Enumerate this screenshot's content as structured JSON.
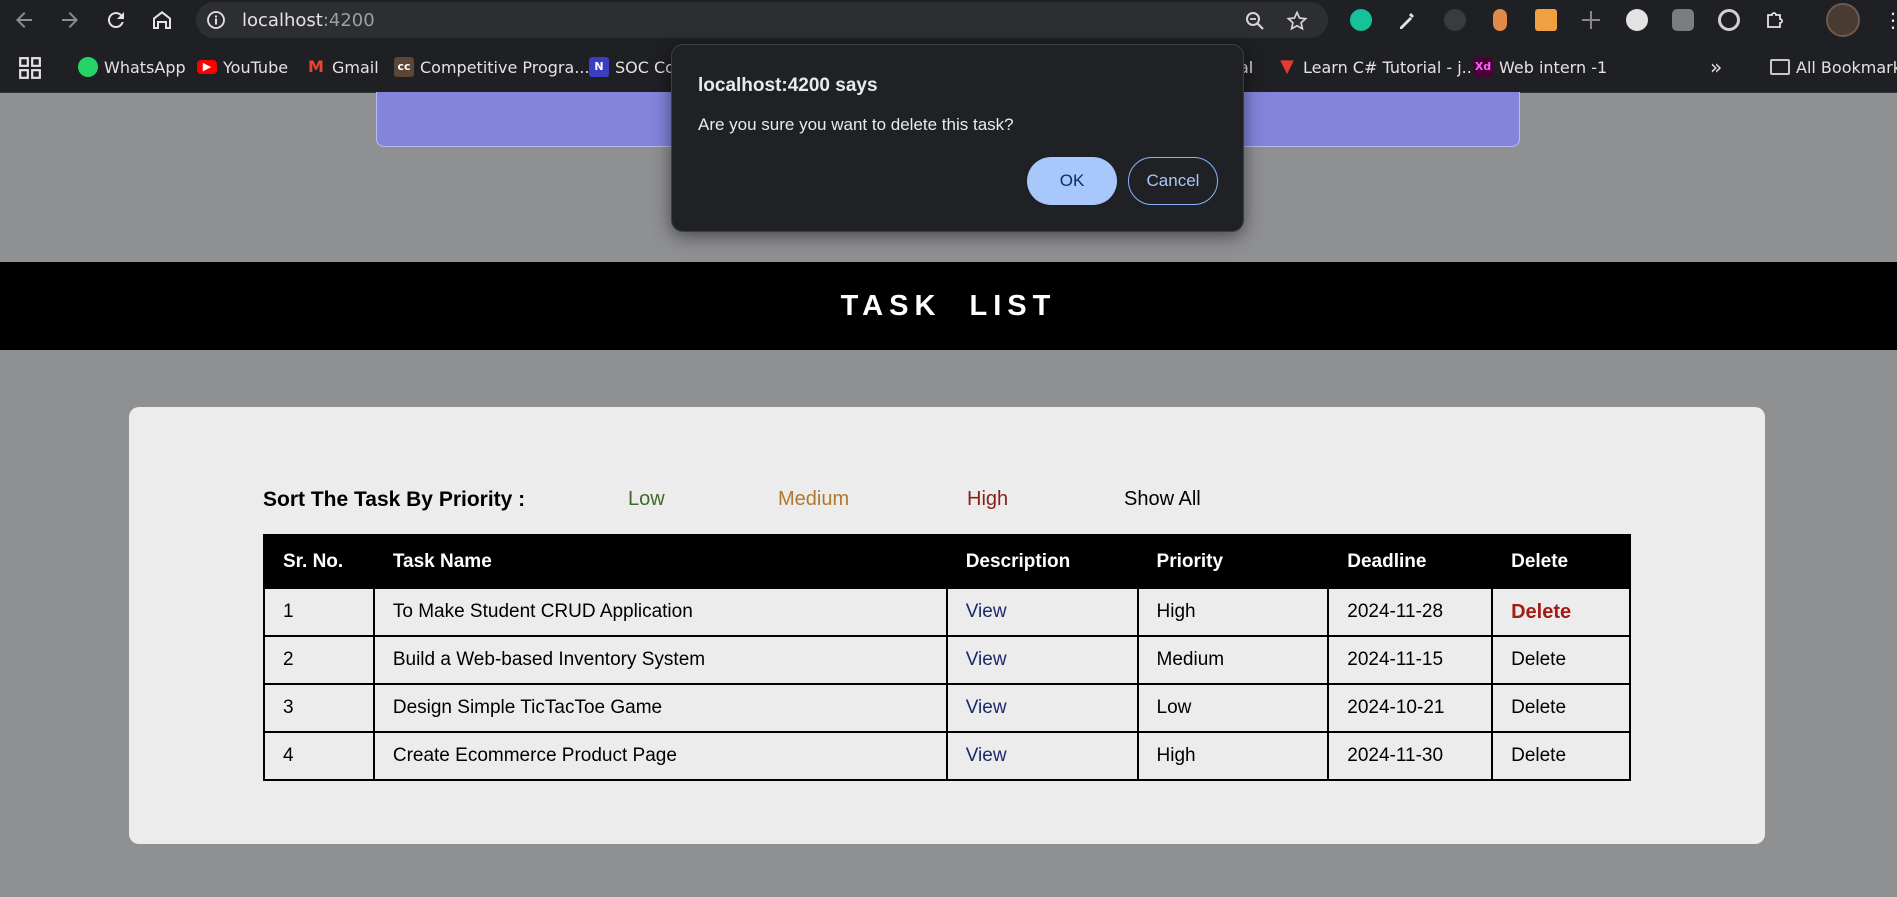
{
  "browser": {
    "url_host": "localhost",
    "url_port": ":4200",
    "bookmarks": [
      {
        "label": "WhatsApp",
        "icon": "whatsapp-icon",
        "color": "#25d366"
      },
      {
        "label": "YouTube",
        "icon": "youtube-icon",
        "color": "#ff0000"
      },
      {
        "label": "Gmail",
        "icon": "gmail-icon",
        "color": "#ea4335"
      },
      {
        "label": "Competitive Progra...",
        "icon": "codechef-icon",
        "color": "#5b4638"
      },
      {
        "label": "SOC Co",
        "icon": "notion-icon",
        "color": "#3b3ec0"
      },
      {
        "label": "al",
        "icon": "",
        "color": ""
      },
      {
        "label": "Learn C# Tutorial - j...",
        "icon": "tutorial-icon",
        "color": "#e53935"
      },
      {
        "label": "Web intern -1",
        "icon": "adobe-xd-icon",
        "color": "#470137"
      },
      {
        "label": "All Bookmarks",
        "icon": "folder-icon",
        "color": ""
      }
    ]
  },
  "page": {
    "banner_title": "TASK  LIST",
    "sort_label": "Sort The Task By Priority :",
    "filters": {
      "low": "Low",
      "medium": "Medium",
      "high": "High",
      "all": "Show All"
    },
    "table": {
      "headers": [
        "Sr. No.",
        "Task Name",
        "Description",
        "Priority",
        "Deadline",
        "Delete"
      ],
      "rows": [
        {
          "sr": "1",
          "name": "To Make Student CRUD Application",
          "desc": "View",
          "priority": "High",
          "deadline": "2024-11-28",
          "delete": "Delete"
        },
        {
          "sr": "2",
          "name": "Build a Web-based Inventory System",
          "desc": "View",
          "priority": "Medium",
          "deadline": "2024-11-15",
          "delete": "Delete"
        },
        {
          "sr": "3",
          "name": "Design Simple TicTacToe Game",
          "desc": "View",
          "priority": "Low",
          "deadline": "2024-10-21",
          "delete": "Delete"
        },
        {
          "sr": "4",
          "name": "Create Ecommerce Product Page",
          "desc": "View",
          "priority": "High",
          "deadline": "2024-11-30",
          "delete": "Delete"
        }
      ]
    }
  },
  "dialog": {
    "title": "localhost:4200 says",
    "message": "Are you sure you want to delete this task?",
    "ok_label": "OK",
    "cancel_label": "Cancel"
  },
  "colors": {
    "banner_bg": "#000000",
    "card_bg": "#ececec",
    "purple_card": "#8385dc",
    "low": "#3b6b2a",
    "medium": "#b0782f",
    "high": "#8a1f1a",
    "delete_hot": "#a31d16",
    "dialog_ok": "#a8c7fa"
  }
}
